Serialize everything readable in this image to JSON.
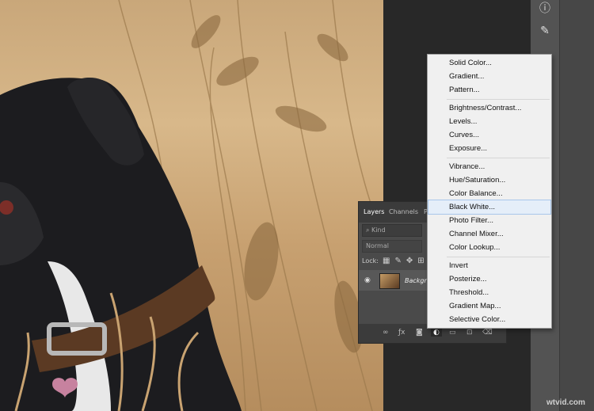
{
  "menu": {
    "items": [
      {
        "label": "Solid Color..."
      },
      {
        "label": "Gradient..."
      },
      {
        "label": "Pattern..."
      },
      {
        "label": "Brightness/Contrast..."
      },
      {
        "label": "Levels..."
      },
      {
        "label": "Curves..."
      },
      {
        "label": "Exposure..."
      },
      {
        "label": "Vibrance..."
      },
      {
        "label": "Hue/Saturation..."
      },
      {
        "label": "Color Balance..."
      },
      {
        "label": "Black  White..."
      },
      {
        "label": "Photo Filter..."
      },
      {
        "label": "Channel Mixer..."
      },
      {
        "label": "Color Lookup..."
      },
      {
        "label": "Invert"
      },
      {
        "label": "Posterize..."
      },
      {
        "label": "Threshold..."
      },
      {
        "label": "Gradient Map..."
      },
      {
        "label": "Selective Color..."
      }
    ],
    "highlighted": "Black  White..."
  },
  "layers_panel": {
    "tabs": [
      "Layers",
      "Channels",
      "P"
    ],
    "filter_kind": "Kind",
    "blend_mode": "Normal",
    "lock_label": "Lock:",
    "layer_name": "Backgro",
    "bottom_icons": [
      "link-icon",
      "fx-icon",
      "mask-icon",
      "adjustment-icon",
      "folder-icon",
      "new-layer-icon",
      "trash-icon"
    ]
  },
  "right_tools": [
    "info-icon",
    "brush-settings-icon",
    "layers-stack-icon"
  ],
  "watermark": "wtvid.com"
}
